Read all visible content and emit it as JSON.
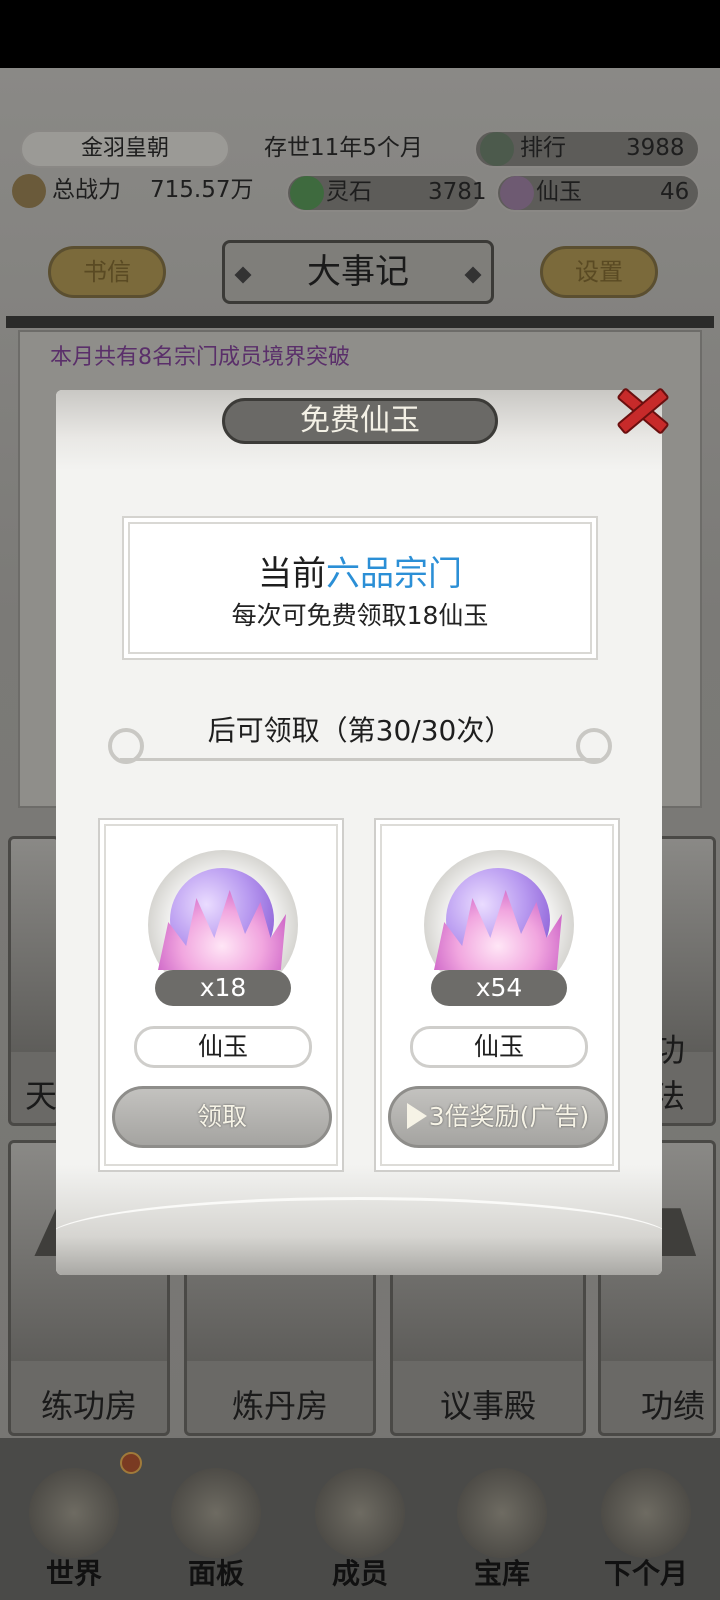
{
  "header": {
    "sect_name": "金羽皇朝",
    "existence": "存世11年5个月",
    "rank_label": "排行",
    "rank_value": "3988",
    "power_label": "总战力",
    "power_value": "715.57万",
    "spirit_stone_label": "灵石",
    "spirit_stone_value": "3781",
    "jade_label": "仙玉",
    "jade_value": "46"
  },
  "top_buttons": {
    "letters": "书信",
    "title": "大事记",
    "settings": "设置"
  },
  "log": {
    "line1": "本月共有8名宗门成员境界突破"
  },
  "buildings": [
    {
      "label": "天"
    },
    {
      "label": "功法"
    },
    {
      "label": "练功房"
    },
    {
      "label": "炼丹房"
    },
    {
      "label": "议事殿"
    },
    {
      "label": "功绩"
    }
  ],
  "bottom_nav": [
    {
      "label": "世界"
    },
    {
      "label": "面板"
    },
    {
      "label": "成员"
    },
    {
      "label": "宝库"
    },
    {
      "label": "下个月"
    }
  ],
  "modal": {
    "title": "免费仙玉",
    "rank_prefix": "当前",
    "rank_name": "六品宗门",
    "rank_desc": "每次可免费领取18仙玉",
    "timer_text": "后可领取（第30/30次）",
    "cards": [
      {
        "qty": "x18",
        "item_name": "仙玉",
        "button": "领取"
      },
      {
        "qty": "x54",
        "item_name": "仙玉",
        "button": "3倍奖励(广告)"
      }
    ]
  },
  "colors": {
    "highlight_blue": "#2b8fd6",
    "close_red": "#c72a2a"
  }
}
